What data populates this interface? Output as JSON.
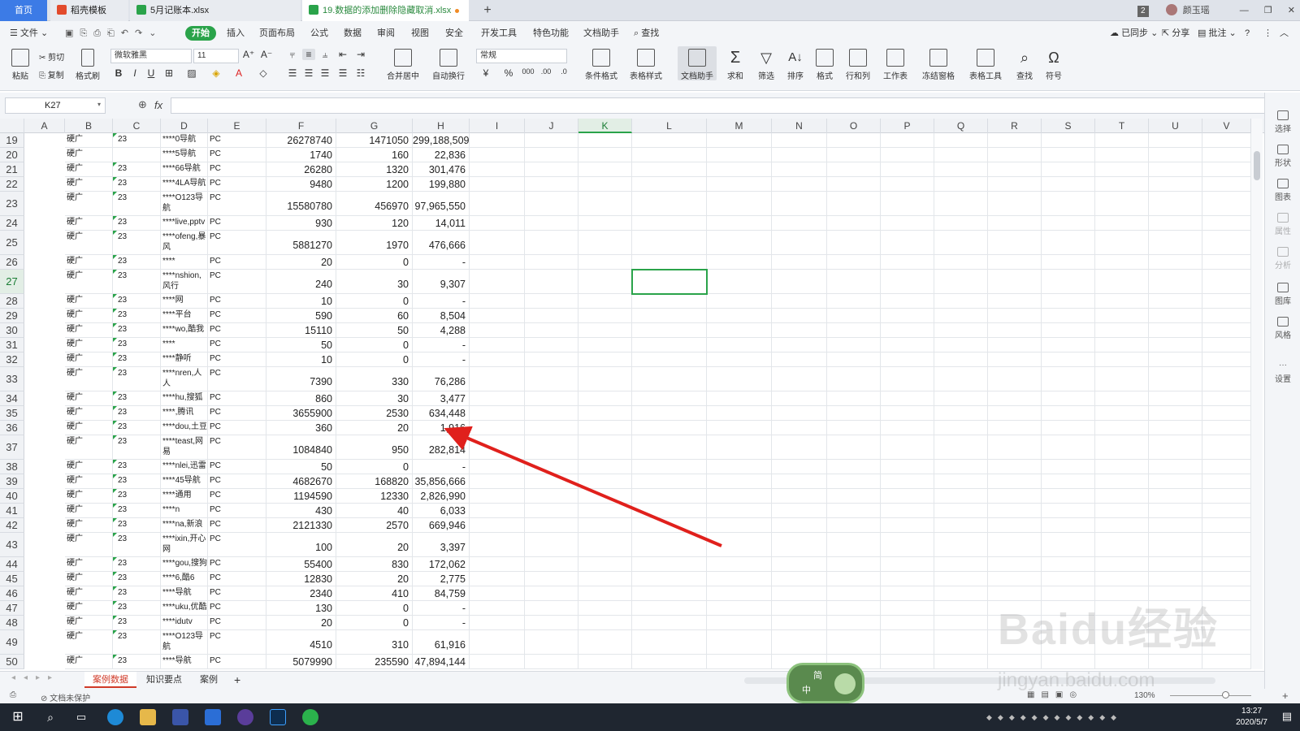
{
  "tabs": {
    "home": "首页",
    "template": "稻壳模板",
    "ledger": "5月记账本.xlsx",
    "active": "19.数据的添加删除隐藏取消.xlsx",
    "new": "+"
  },
  "titlebar": {
    "badge": "2",
    "user": "颜玉瑶"
  },
  "menu": {
    "file": "文件",
    "items": [
      "开始",
      "插入",
      "页面布局",
      "公式",
      "数据",
      "审阅",
      "视图",
      "安全",
      "开发工具",
      "特色功能",
      "文档助手"
    ],
    "search": "查找",
    "sync": "已同步",
    "share": "分享",
    "comment": "批注"
  },
  "ribbon": {
    "paste": "粘贴",
    "cut": "剪切",
    "copy": "复制",
    "format_painter": "格式刷",
    "font": "微软雅黑",
    "size": "11",
    "number_format": "常规",
    "merge": "合并居中",
    "wrap": "自动换行",
    "cond": "条件格式",
    "table_style": "表格样式",
    "doc_helper": "文档助手",
    "sum": "求和",
    "filter": "筛选",
    "sort": "排序",
    "format": "格式",
    "rowcol": "行和列",
    "sheet": "工作表",
    "freeze": "冻结窗格",
    "table_tools": "表格工具",
    "find": "查找",
    "symbol": "符号"
  },
  "formula": {
    "cell": "K27",
    "fx": "fx",
    "value": ""
  },
  "columns": [
    "A",
    "B",
    "C",
    "D",
    "E",
    "F",
    "G",
    "H",
    "I",
    "J",
    "K",
    "L",
    "M",
    "N",
    "O",
    "P",
    "Q",
    "R",
    "S",
    "T",
    "U",
    "V"
  ],
  "rows": [
    {
      "n": "19",
      "a": "硬广",
      "b": "23",
      "c": "****0导航",
      "d": "PC",
      "e": "26278740",
      "f": "1471050",
      "g": "299,188,509"
    },
    {
      "n": "20",
      "a": "硬广",
      "b": "",
      "c": "****5导航",
      "d": "PC",
      "e": "1740",
      "f": "160",
      "g": "22,836"
    },
    {
      "n": "21",
      "a": "硬广",
      "b": "23",
      "c": "****66导航",
      "d": "PC",
      "e": "26280",
      "f": "1320",
      "g": "301,476"
    },
    {
      "n": "22",
      "a": "硬广",
      "b": "23",
      "c": "****4LA导航",
      "d": "PC",
      "e": "9480",
      "f": "1200",
      "g": "199,880"
    },
    {
      "n": "23",
      "a": "硬广",
      "b": "23",
      "c": "****O123导航",
      "d": "PC",
      "e": "15580780",
      "f": "456970",
      "g": "97,965,550"
    },
    {
      "n": "24",
      "a": "硬广",
      "b": "23",
      "c": "****live,pptv",
      "d": "PC",
      "e": "930",
      "f": "120",
      "g": "14,011"
    },
    {
      "n": "25",
      "a": "硬广",
      "b": "23",
      "c": "****ofeng,暴风",
      "d": "PC",
      "e": "5881270",
      "f": "1970",
      "g": "476,666"
    },
    {
      "n": "26",
      "a": "硬广",
      "b": "23",
      "c": "****",
      "d": "PC",
      "e": "20",
      "f": "0",
      "g": "-"
    },
    {
      "n": "27",
      "a": "硬广",
      "b": "23",
      "c": "****nshion,风行",
      "d": "PC",
      "e": "240",
      "f": "30",
      "g": "9,307"
    },
    {
      "n": "28",
      "a": "硬广",
      "b": "23",
      "c": "****网",
      "d": "PC",
      "e": "10",
      "f": "0",
      "g": "-"
    },
    {
      "n": "29",
      "a": "硬广",
      "b": "23",
      "c": "****平台",
      "d": "PC",
      "e": "590",
      "f": "60",
      "g": "8,504"
    },
    {
      "n": "30",
      "a": "硬广",
      "b": "23",
      "c": "****wo,酷我",
      "d": "PC",
      "e": "15110",
      "f": "50",
      "g": "4,288"
    },
    {
      "n": "31",
      "a": "硬广",
      "b": "23",
      "c": "****",
      "d": "PC",
      "e": "50",
      "f": "0",
      "g": "-"
    },
    {
      "n": "32",
      "a": "硬广",
      "b": "23",
      "c": "****静听",
      "d": "PC",
      "e": "10",
      "f": "0",
      "g": "-"
    },
    {
      "n": "33",
      "a": "硬广",
      "b": "23",
      "c": "****nren,人人",
      "d": "PC",
      "e": "7390",
      "f": "330",
      "g": "76,286"
    },
    {
      "n": "34",
      "a": "硬广",
      "b": "23",
      "c": "****hu,搜狐",
      "d": "PC",
      "e": "860",
      "f": "30",
      "g": "3,477"
    },
    {
      "n": "35",
      "a": "硬广",
      "b": "23",
      "c": "****,腾讯",
      "d": "PC",
      "e": "3655900",
      "f": "2530",
      "g": "634,448"
    },
    {
      "n": "36",
      "a": "硬广",
      "b": "23",
      "c": "****dou,土豆",
      "d": "PC",
      "e": "360",
      "f": "20",
      "g": "1,916"
    },
    {
      "n": "37",
      "a": "硬广",
      "b": "23",
      "c": "****teast,网易",
      "d": "PC",
      "e": "1084840",
      "f": "950",
      "g": "282,814"
    },
    {
      "n": "38",
      "a": "硬广",
      "b": "23",
      "c": "****nlei,迅雷",
      "d": "PC",
      "e": "50",
      "f": "0",
      "g": "-"
    },
    {
      "n": "39",
      "a": "硬广",
      "b": "23",
      "c": "****45导航",
      "d": "PC",
      "e": "4682670",
      "f": "168820",
      "g": "35,856,666"
    },
    {
      "n": "40",
      "a": "硬广",
      "b": "23",
      "c": "****通用",
      "d": "PC",
      "e": "1194590",
      "f": "12330",
      "g": "2,826,990"
    },
    {
      "n": "41",
      "a": "硬广",
      "b": "23",
      "c": "****n",
      "d": "PC",
      "e": "430",
      "f": "40",
      "g": "6,033"
    },
    {
      "n": "42",
      "a": "硬广",
      "b": "23",
      "c": "****na,新浪",
      "d": "PC",
      "e": "2121330",
      "f": "2570",
      "g": "669,946"
    },
    {
      "n": "43",
      "a": "硬广",
      "b": "23",
      "c": "****ixin,开心网",
      "d": "PC",
      "e": "100",
      "f": "20",
      "g": "3,397"
    },
    {
      "n": "44",
      "a": "硬广",
      "b": "23",
      "c": "****gou,搜狗",
      "d": "PC",
      "e": "55400",
      "f": "830",
      "g": "172,062"
    },
    {
      "n": "45",
      "a": "硬广",
      "b": "23",
      "c": "****6,酷6",
      "d": "PC",
      "e": "12830",
      "f": "20",
      "g": "2,775"
    },
    {
      "n": "46",
      "a": "硬广",
      "b": "23",
      "c": "****导航",
      "d": "PC",
      "e": "2340",
      "f": "410",
      "g": "84,759"
    },
    {
      "n": "47",
      "a": "硬广",
      "b": "23",
      "c": "****uku,优酷",
      "d": "PC",
      "e": "130",
      "f": "0",
      "g": "-"
    },
    {
      "n": "48",
      "a": "硬广",
      "b": "23",
      "c": "****idutv",
      "d": "PC",
      "e": "20",
      "f": "0",
      "g": "-"
    },
    {
      "n": "49",
      "a": "硬广",
      "b": "23",
      "c": "****O123导航",
      "d": "PC",
      "e": "4510",
      "f": "310",
      "g": "61,916"
    },
    {
      "n": "50",
      "a": "硬广",
      "b": "23",
      "c": "****导航",
      "d": "PC",
      "e": "5079990",
      "f": "235590",
      "g": "47,894,144"
    }
  ],
  "sheets": [
    "案例数据",
    "知识要点",
    "案例"
  ],
  "status": {
    "protect": "文档未保护",
    "zoom": "130%"
  },
  "side": [
    "选择",
    "形状",
    "图表",
    "属性",
    "分析",
    "图库",
    "风格",
    "设置"
  ],
  "ime": {
    "top": "简",
    "mid": "中"
  },
  "watermark": {
    "main": "Baidu经验",
    "sub": "jingyan.baidu.com"
  },
  "clock": {
    "time": "13:27",
    "date": "2020/5/7"
  },
  "colors": {
    "accent": "#2aa34a",
    "arrow": "#e0201c",
    "home": "#3c7be6"
  }
}
